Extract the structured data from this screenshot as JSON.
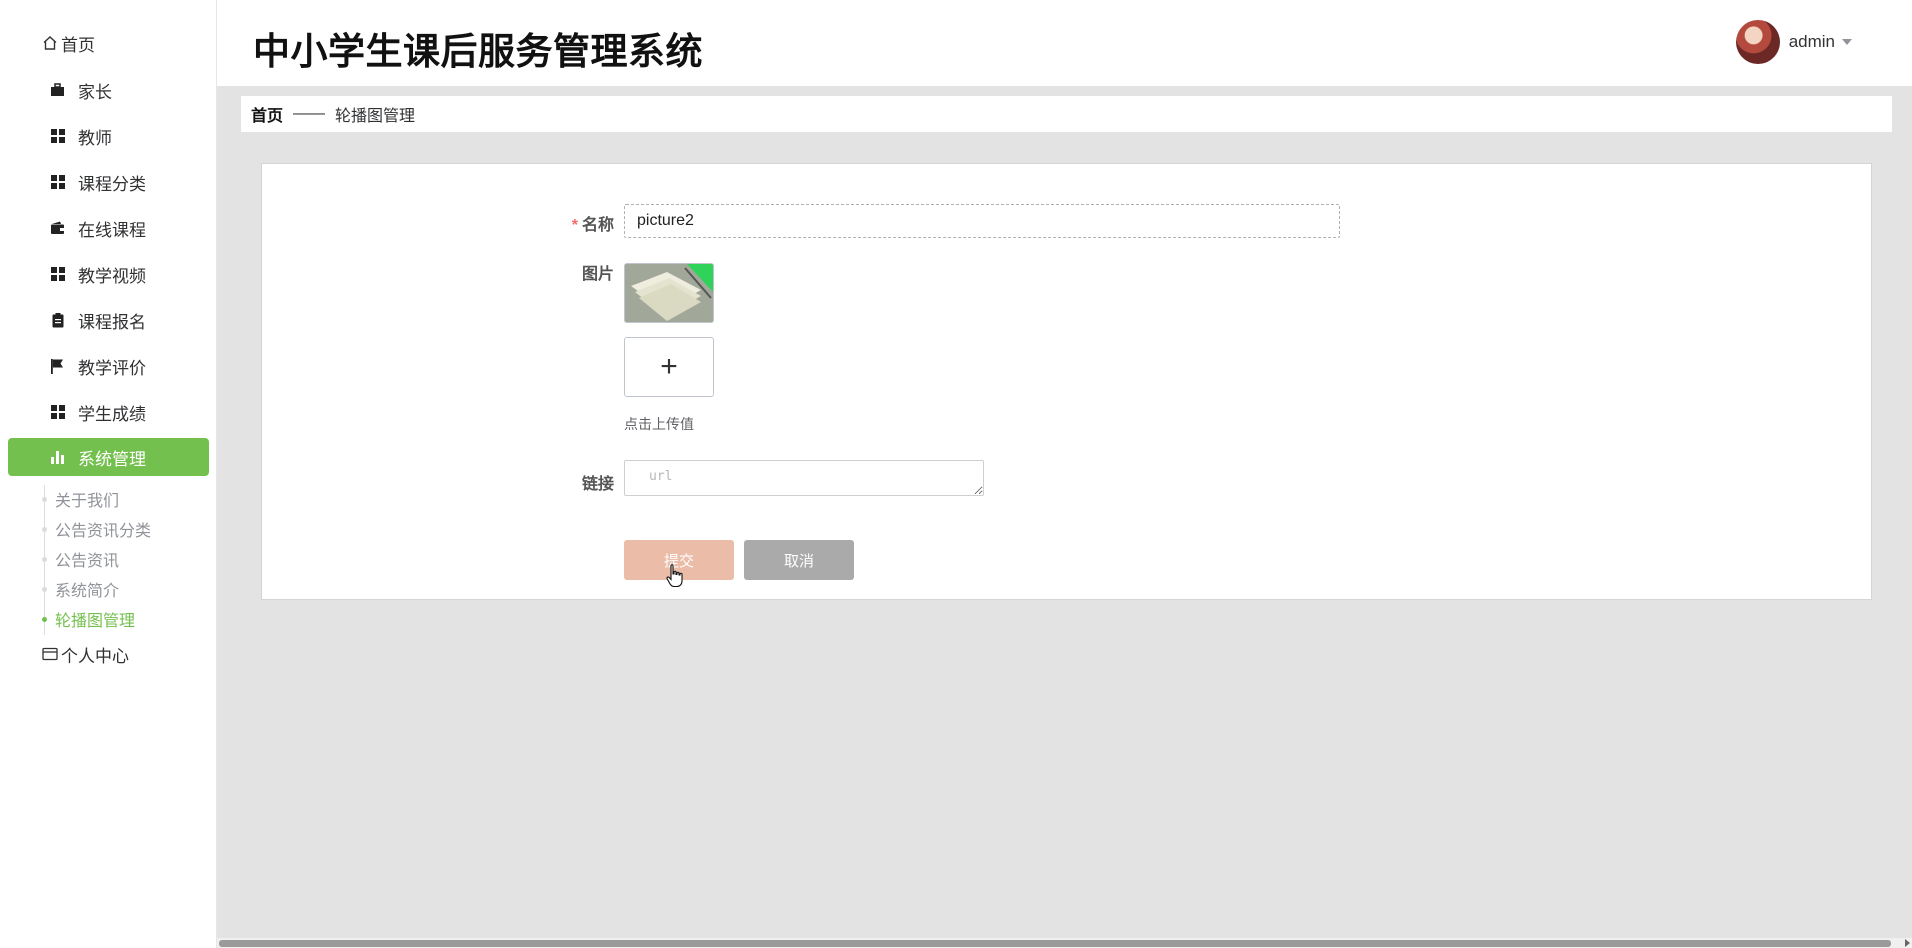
{
  "sidebar": {
    "home_label": "首页",
    "items": [
      {
        "label": "家长",
        "icon": "briefcase-icon"
      },
      {
        "label": "教师",
        "icon": "grid-icon"
      },
      {
        "label": "课程分类",
        "icon": "grid-icon"
      },
      {
        "label": "在线课程",
        "icon": "wallet-icon"
      },
      {
        "label": "教学视频",
        "icon": "grid-icon"
      },
      {
        "label": "课程报名",
        "icon": "clipboard-icon"
      },
      {
        "label": "教学评价",
        "icon": "flag-icon"
      },
      {
        "label": "学生成绩",
        "icon": "grid-icon"
      },
      {
        "label": "系统管理",
        "icon": "bar-chart-icon"
      }
    ],
    "submenu": [
      "关于我们",
      "公告资讯分类",
      "公告资讯",
      "系统简介",
      "轮播图管理"
    ],
    "personal_center_label": "个人中心",
    "active_item": "系统管理",
    "active_subitem": "轮播图管理"
  },
  "header": {
    "title": "中小学生课后服务管理系统",
    "username": "admin"
  },
  "breadcrumb": {
    "home": "首页",
    "separator": "——",
    "current": "轮播图管理"
  },
  "form": {
    "name_required_mark": "*",
    "name_label": "名称",
    "name_value": "picture2",
    "image_label": "图片",
    "upload_plus": "+",
    "upload_tip": "点击上传值",
    "link_label": "链接",
    "link_placeholder": "url",
    "submit_label": "提交",
    "cancel_label": "取消"
  },
  "colors": {
    "accent": "#74c04f",
    "submit_button": "#ebbda8",
    "cancel_button": "#aaaaaa",
    "required": "#f56c6c",
    "main_bg": "#e3e3e3"
  }
}
